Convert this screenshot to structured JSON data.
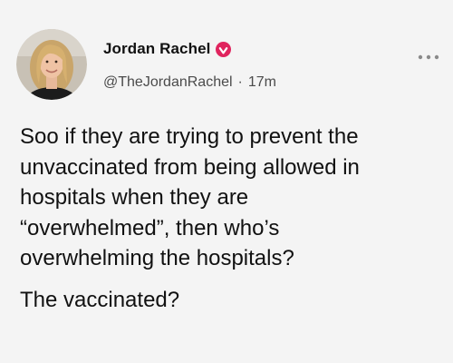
{
  "author": {
    "display_name": "Jordan Rachel",
    "handle": "@TheJordanRachel",
    "separator": "·",
    "time": "17m",
    "verified": true,
    "verified_color": "#e0245e",
    "avatar_icon": "profile-photo"
  },
  "menu": {
    "icon": "more-horizontal-icon"
  },
  "post": {
    "paragraphs": [
      {
        "lines": [
          "Soo if they are trying to prevent the",
          "unvaccinated from being allowed in",
          "hospitals when they are",
          "“overwhelmed”, then who’s",
          "overwhelming the hospitals?"
        ]
      },
      {
        "lines": [
          "The vaccinated?"
        ]
      }
    ]
  },
  "colors": {
    "background": "#f4f4f4",
    "text": "#111111",
    "secondary_text": "#4b4b4b"
  }
}
